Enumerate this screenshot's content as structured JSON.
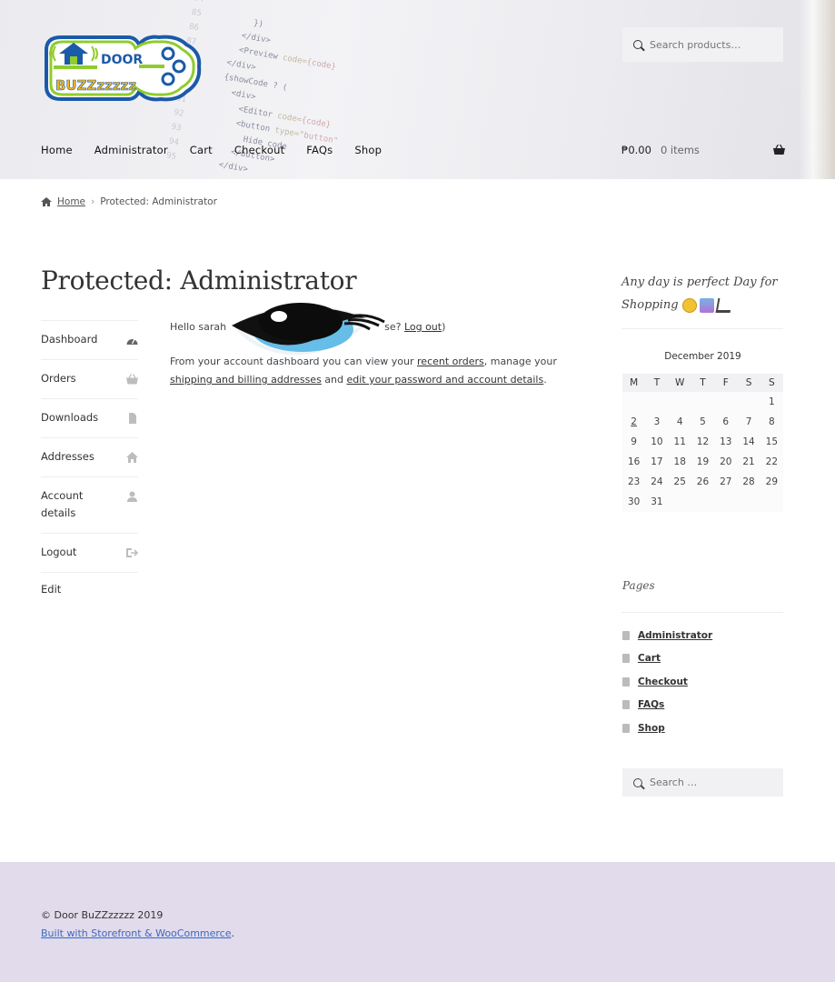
{
  "site": {
    "nav": [
      "Home",
      "Administrator",
      "Cart",
      "Checkout",
      "FAQs",
      "Shop"
    ],
    "search_placeholder": "Search products…",
    "cart_amount": "₱0.00",
    "cart_items": "0 items"
  },
  "breadcrumb": {
    "home": "Home",
    "current": "Protected: Administrator"
  },
  "page": {
    "title": "Protected: Administrator",
    "hello_prefix": "Hello sarah",
    "hello_suffix": "se?",
    "logout_link": "Log out",
    "close_paren": ")",
    "dashboard_text_1": "From your account dashboard you can view your ",
    "recent_orders": "recent orders",
    "dashboard_text_2": ", manage your ",
    "addresses_link": "shipping and billing addresses",
    "dashboard_text_3": " and ",
    "account_link": "edit your password and account details",
    "dashboard_text_4": "."
  },
  "account_nav": {
    "items": [
      {
        "label": "Dashboard",
        "icon": "dashboard-icon"
      },
      {
        "label": "Orders",
        "icon": "basket-icon"
      },
      {
        "label": "Downloads",
        "icon": "file-icon"
      },
      {
        "label": "Addresses",
        "icon": "home-icon"
      },
      {
        "label": "Account details",
        "icon": "user-icon"
      },
      {
        "label": "Logout",
        "icon": "sign-out-icon"
      }
    ],
    "edit": "Edit"
  },
  "sidebar": {
    "tagline": "Any day is perfect Day for Shopping",
    "calendar": {
      "caption": "December 2019",
      "weekdays": [
        "M",
        "T",
        "W",
        "T",
        "F",
        "S",
        "S"
      ],
      "weeks": [
        [
          "",
          "",
          "",
          "",
          "",
          "",
          "1"
        ],
        [
          "2",
          "3",
          "4",
          "5",
          "6",
          "7",
          "8"
        ],
        [
          "9",
          "10",
          "11",
          "12",
          "13",
          "14",
          "15"
        ],
        [
          "16",
          "17",
          "18",
          "19",
          "20",
          "21",
          "22"
        ],
        [
          "23",
          "24",
          "25",
          "26",
          "27",
          "28",
          "29"
        ],
        [
          "30",
          "31",
          "",
          "",
          "",
          "",
          ""
        ]
      ],
      "linked_day": "2"
    },
    "pages_heading": "Pages",
    "pages": [
      "Administrator",
      "Cart",
      "Checkout",
      "FAQs",
      "Shop"
    ],
    "search_placeholder": "Search …"
  },
  "footer": {
    "copyright": "© Door BuZZzzzzz 2019",
    "built_with": "Built with Storefront & WooCommerce",
    "built_after": "."
  },
  "colors": {
    "footer_bg": "#e2dbeb",
    "link_blue": "#3a69c5",
    "logo_blue": "#1b5aa8",
    "logo_green": "#8fcc2d"
  }
}
